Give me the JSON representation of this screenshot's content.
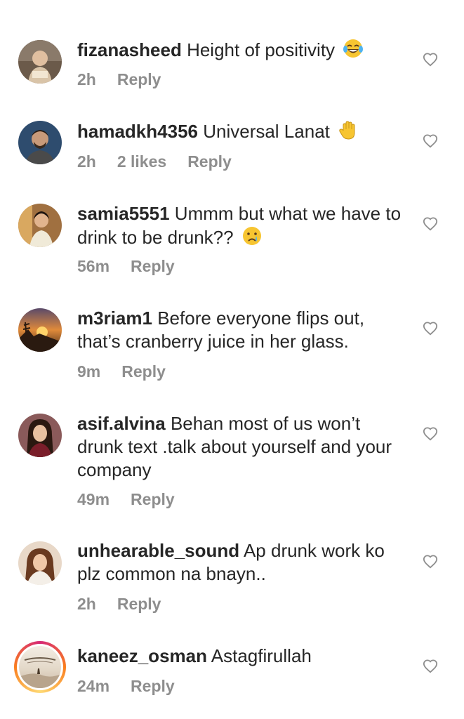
{
  "comments": [
    {
      "username": "fizanasheed",
      "text": "Height of positivity",
      "time": "2h",
      "likes": "",
      "reply": "Reply",
      "emoji": "laughing-tears-emoji"
    },
    {
      "username": "hamadkh4356",
      "text": "Universal Lanat",
      "time": "2h",
      "likes": "2 likes",
      "reply": "Reply",
      "emoji": "raised-hand-emoji"
    },
    {
      "username": "samia5551",
      "text": "Ummm but what we have to drink to be drunk??",
      "time": "56m",
      "likes": "",
      "reply": "Reply",
      "emoji": "crying-face-emoji"
    },
    {
      "username": "m3riam1",
      "text": "Before everyone flips out, that’s cranberry juice in her glass.",
      "time": "9m",
      "likes": "",
      "reply": "Reply",
      "emoji": ""
    },
    {
      "username": "asif.alvina",
      "text": "Behan most of us won’t drunk text .talk about yourself and your company",
      "time": "49m",
      "likes": "",
      "reply": "Reply",
      "emoji": ""
    },
    {
      "username": "unhearable_sound",
      "text": "Ap drunk work ko plz common na bnayn..",
      "time": "2h",
      "likes": "",
      "reply": "Reply",
      "emoji": ""
    },
    {
      "username": "kaneez_osman",
      "text": "Astagfirullah",
      "time": "24m",
      "likes": "",
      "reply": "Reply",
      "emoji": ""
    }
  ],
  "colors": {
    "text": "#262626",
    "meta": "#8e8e8e",
    "heart": "#8e8e8e"
  }
}
